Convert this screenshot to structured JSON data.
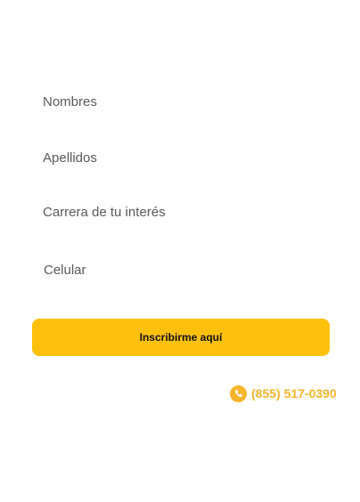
{
  "form": {
    "nombres_placeholder": "Nombres",
    "apellidos_placeholder": "Apellidos",
    "carrera_placeholder": "Carrera de tu interés",
    "celular_placeholder": "Celular",
    "submit_label": "Inscribirme aquí"
  },
  "contact": {
    "phone": "(855) 517-0390",
    "icon": "phone-icon"
  },
  "colors": {
    "accent": "#FDC10D",
    "phone": "#F7B52C",
    "placeholder": "#5a5a5a"
  }
}
